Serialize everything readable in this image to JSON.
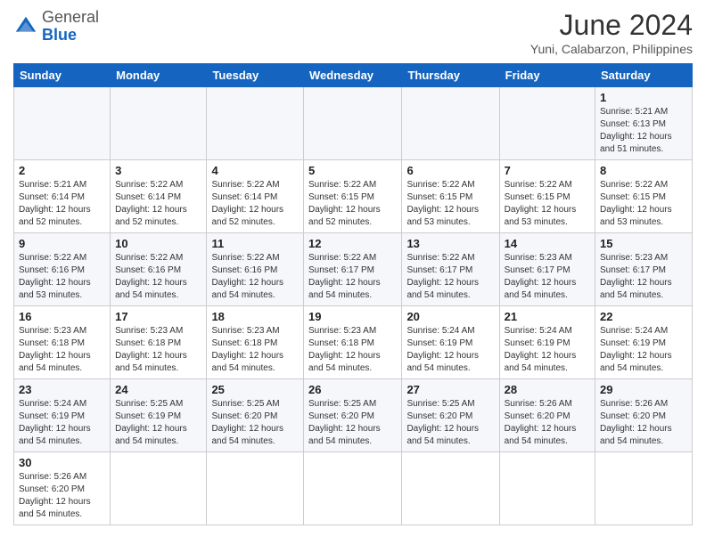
{
  "header": {
    "logo": {
      "general": "General",
      "blue": "Blue"
    },
    "title": "June 2024",
    "subtitle": "Yuni, Calabarzon, Philippines"
  },
  "days_of_week": [
    "Sunday",
    "Monday",
    "Tuesday",
    "Wednesday",
    "Thursday",
    "Friday",
    "Saturday"
  ],
  "weeks": [
    [
      {
        "day": "",
        "info": ""
      },
      {
        "day": "",
        "info": ""
      },
      {
        "day": "",
        "info": ""
      },
      {
        "day": "",
        "info": ""
      },
      {
        "day": "",
        "info": ""
      },
      {
        "day": "",
        "info": ""
      },
      {
        "day": "1",
        "info": "Sunrise: 5:21 AM\nSunset: 6:13 PM\nDaylight: 12 hours\nand 51 minutes."
      }
    ],
    [
      {
        "day": "2",
        "info": "Sunrise: 5:21 AM\nSunset: 6:14 PM\nDaylight: 12 hours\nand 52 minutes."
      },
      {
        "day": "3",
        "info": "Sunrise: 5:22 AM\nSunset: 6:14 PM\nDaylight: 12 hours\nand 52 minutes."
      },
      {
        "day": "4",
        "info": "Sunrise: 5:22 AM\nSunset: 6:14 PM\nDaylight: 12 hours\nand 52 minutes."
      },
      {
        "day": "5",
        "info": "Sunrise: 5:22 AM\nSunset: 6:15 PM\nDaylight: 12 hours\nand 52 minutes."
      },
      {
        "day": "6",
        "info": "Sunrise: 5:22 AM\nSunset: 6:15 PM\nDaylight: 12 hours\nand 53 minutes."
      },
      {
        "day": "7",
        "info": "Sunrise: 5:22 AM\nSunset: 6:15 PM\nDaylight: 12 hours\nand 53 minutes."
      },
      {
        "day": "8",
        "info": "Sunrise: 5:22 AM\nSunset: 6:15 PM\nDaylight: 12 hours\nand 53 minutes."
      }
    ],
    [
      {
        "day": "9",
        "info": "Sunrise: 5:22 AM\nSunset: 6:16 PM\nDaylight: 12 hours\nand 53 minutes."
      },
      {
        "day": "10",
        "info": "Sunrise: 5:22 AM\nSunset: 6:16 PM\nDaylight: 12 hours\nand 54 minutes."
      },
      {
        "day": "11",
        "info": "Sunrise: 5:22 AM\nSunset: 6:16 PM\nDaylight: 12 hours\nand 54 minutes."
      },
      {
        "day": "12",
        "info": "Sunrise: 5:22 AM\nSunset: 6:17 PM\nDaylight: 12 hours\nand 54 minutes."
      },
      {
        "day": "13",
        "info": "Sunrise: 5:22 AM\nSunset: 6:17 PM\nDaylight: 12 hours\nand 54 minutes."
      },
      {
        "day": "14",
        "info": "Sunrise: 5:23 AM\nSunset: 6:17 PM\nDaylight: 12 hours\nand 54 minutes."
      },
      {
        "day": "15",
        "info": "Sunrise: 5:23 AM\nSunset: 6:17 PM\nDaylight: 12 hours\nand 54 minutes."
      }
    ],
    [
      {
        "day": "16",
        "info": "Sunrise: 5:23 AM\nSunset: 6:18 PM\nDaylight: 12 hours\nand 54 minutes."
      },
      {
        "day": "17",
        "info": "Sunrise: 5:23 AM\nSunset: 6:18 PM\nDaylight: 12 hours\nand 54 minutes."
      },
      {
        "day": "18",
        "info": "Sunrise: 5:23 AM\nSunset: 6:18 PM\nDaylight: 12 hours\nand 54 minutes."
      },
      {
        "day": "19",
        "info": "Sunrise: 5:23 AM\nSunset: 6:18 PM\nDaylight: 12 hours\nand 54 minutes."
      },
      {
        "day": "20",
        "info": "Sunrise: 5:24 AM\nSunset: 6:19 PM\nDaylight: 12 hours\nand 54 minutes."
      },
      {
        "day": "21",
        "info": "Sunrise: 5:24 AM\nSunset: 6:19 PM\nDaylight: 12 hours\nand 54 minutes."
      },
      {
        "day": "22",
        "info": "Sunrise: 5:24 AM\nSunset: 6:19 PM\nDaylight: 12 hours\nand 54 minutes."
      }
    ],
    [
      {
        "day": "23",
        "info": "Sunrise: 5:24 AM\nSunset: 6:19 PM\nDaylight: 12 hours\nand 54 minutes."
      },
      {
        "day": "24",
        "info": "Sunrise: 5:25 AM\nSunset: 6:19 PM\nDaylight: 12 hours\nand 54 minutes."
      },
      {
        "day": "25",
        "info": "Sunrise: 5:25 AM\nSunset: 6:20 PM\nDaylight: 12 hours\nand 54 minutes."
      },
      {
        "day": "26",
        "info": "Sunrise: 5:25 AM\nSunset: 6:20 PM\nDaylight: 12 hours\nand 54 minutes."
      },
      {
        "day": "27",
        "info": "Sunrise: 5:25 AM\nSunset: 6:20 PM\nDaylight: 12 hours\nand 54 minutes."
      },
      {
        "day": "28",
        "info": "Sunrise: 5:26 AM\nSunset: 6:20 PM\nDaylight: 12 hours\nand 54 minutes."
      },
      {
        "day": "29",
        "info": "Sunrise: 5:26 AM\nSunset: 6:20 PM\nDaylight: 12 hours\nand 54 minutes."
      }
    ],
    [
      {
        "day": "30",
        "info": "Sunrise: 5:26 AM\nSunset: 6:20 PM\nDaylight: 12 hours\nand 54 minutes."
      },
      {
        "day": "",
        "info": ""
      },
      {
        "day": "",
        "info": ""
      },
      {
        "day": "",
        "info": ""
      },
      {
        "day": "",
        "info": ""
      },
      {
        "day": "",
        "info": ""
      },
      {
        "day": "",
        "info": ""
      }
    ]
  ]
}
